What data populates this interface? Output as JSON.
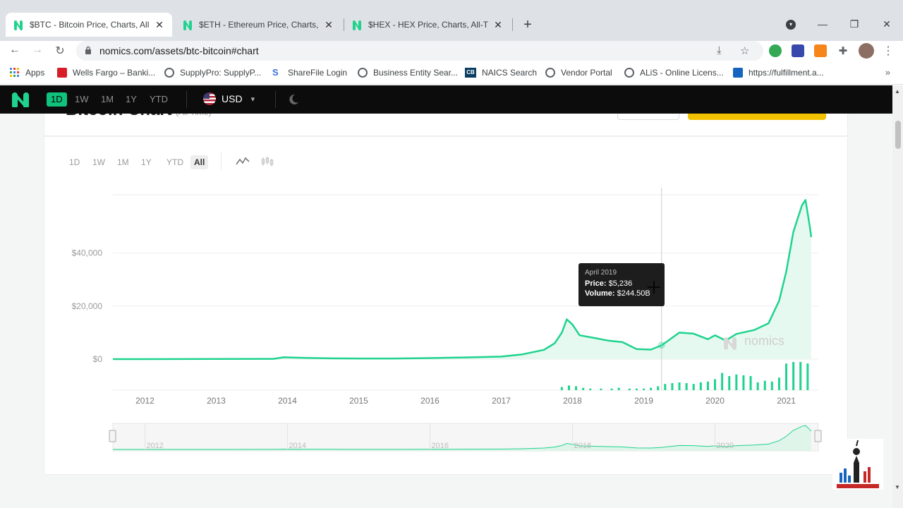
{
  "browser": {
    "tabs": [
      {
        "title": "$BTC - Bitcoin Price, Charts, All-T",
        "active": true
      },
      {
        "title": "$ETH - Ethereum Price, Charts, Al",
        "active": false
      },
      {
        "title": "$HEX - HEX Price, Charts, All-Tim",
        "active": false
      }
    ],
    "url": "nomics.com/assets/btc-bitcoin#chart",
    "bookmarks": [
      {
        "label": "Apps",
        "icon": "apps-grid-icon",
        "color": "#4285f4"
      },
      {
        "label": "Wells Fargo – Banki...",
        "icon": "wells-fargo-icon",
        "color": "#d71e28"
      },
      {
        "label": "SupplyPro: SupplyP...",
        "icon": "globe-icon",
        "color": "#5f6368"
      },
      {
        "label": "ShareFile Login",
        "icon": "sharefile-icon",
        "color": "#3b6fd8"
      },
      {
        "label": "Business Entity Sear...",
        "icon": "globe-icon",
        "color": "#5f6368"
      },
      {
        "label": "NAICS Search",
        "icon": "cb-icon",
        "color": "#0a3d62"
      },
      {
        "label": "Vendor Portal",
        "icon": "globe-icon",
        "color": "#5f6368"
      },
      {
        "label": "ALiS - Online Licens...",
        "icon": "globe-icon",
        "color": "#5f6368"
      },
      {
        "label": "https://fulfillment.a...",
        "icon": "fulfillment-icon",
        "color": "#1565c0"
      }
    ],
    "bookmarks_more": "»"
  },
  "appbar": {
    "ranges": [
      "1D",
      "1W",
      "1M",
      "1Y",
      "YTD"
    ],
    "active_range": "1D",
    "currency": "USD",
    "accent": "#10c27c"
  },
  "card": {
    "title": "Bitcoin Chart",
    "subtitle": "(All Time)"
  },
  "chart_controls": {
    "ranges": [
      "1D",
      "1W",
      "1M",
      "1Y",
      "YTD",
      "All"
    ],
    "active_range": "All"
  },
  "tooltip": {
    "date": "April 2019",
    "price_label": "Price:",
    "price_value": "$5,236",
    "volume_label": "Volume:",
    "volume_value": "$244.50B"
  },
  "chart_data": {
    "type": "area",
    "title": "",
    "xlabel": "",
    "ylabel": "",
    "x_ticks": [
      "2012",
      "2013",
      "2014",
      "2015",
      "2016",
      "2017",
      "2018",
      "2019",
      "2020",
      "2021"
    ],
    "y_ticks": [
      "$0",
      "$20,000",
      "$40,000"
    ],
    "ylim": [
      0,
      62000
    ],
    "xlim": [
      2011.55,
      2021.45
    ],
    "line_color": "#1fd38e",
    "watermark": "nomics",
    "series": [
      {
        "values": [
          [
            2011.55,
            0
          ],
          [
            2012.0,
            10
          ],
          [
            2013.0,
            50
          ],
          [
            2013.8,
            100
          ],
          [
            2013.95,
            700
          ],
          [
            2014.2,
            500
          ],
          [
            2014.6,
            300
          ],
          [
            2015.0,
            250
          ],
          [
            2015.5,
            250
          ],
          [
            2016.0,
            400
          ],
          [
            2016.5,
            650
          ],
          [
            2017.0,
            950
          ],
          [
            2017.3,
            1800
          ],
          [
            2017.6,
            3500
          ],
          [
            2017.75,
            6000
          ],
          [
            2017.85,
            10000
          ],
          [
            2017.92,
            15000
          ],
          [
            2018.0,
            13000
          ],
          [
            2018.1,
            9000
          ],
          [
            2018.3,
            8000
          ],
          [
            2018.5,
            7000
          ],
          [
            2018.7,
            6400
          ],
          [
            2018.9,
            3800
          ],
          [
            2019.1,
            3600
          ],
          [
            2019.25,
            5200
          ],
          [
            2019.5,
            10000
          ],
          [
            2019.7,
            9600
          ],
          [
            2019.9,
            7500
          ],
          [
            2020.0,
            9000
          ],
          [
            2020.15,
            7000
          ],
          [
            2020.3,
            9500
          ],
          [
            2020.55,
            11000
          ],
          [
            2020.75,
            13500
          ],
          [
            2020.9,
            22000
          ],
          [
            2021.0,
            33000
          ],
          [
            2021.1,
            48000
          ],
          [
            2021.22,
            58000
          ],
          [
            2021.27,
            60000
          ],
          [
            2021.33,
            50000
          ],
          [
            2021.35,
            46000
          ]
        ]
      }
    ],
    "volume": {
      "x": [
        2017.85,
        2017.95,
        2018.05,
        2018.15,
        2018.25,
        2018.4,
        2018.55,
        2018.65,
        2018.8,
        2018.9,
        2019.0,
        2019.1,
        2019.2,
        2019.3,
        2019.4,
        2019.5,
        2019.6,
        2019.7,
        2019.8,
        2019.9,
        2020.0,
        2020.1,
        2020.2,
        2020.3,
        2020.4,
        2020.5,
        2020.6,
        2020.7,
        2020.8,
        2020.9,
        2021.0,
        2021.1,
        2021.2,
        2021.3
      ],
      "values": [
        4,
        6,
        5,
        3,
        2,
        2,
        2,
        3,
        2,
        2,
        2,
        3,
        5,
        8,
        9,
        10,
        9,
        8,
        10,
        11,
        14,
        22,
        18,
        20,
        19,
        18,
        10,
        12,
        11,
        16,
        34,
        36,
        36,
        34
      ]
    },
    "navigator_ticks": [
      "2012",
      "2014",
      "2016",
      "2018",
      "2020"
    ]
  },
  "site_logo": "freedomtv-logo"
}
